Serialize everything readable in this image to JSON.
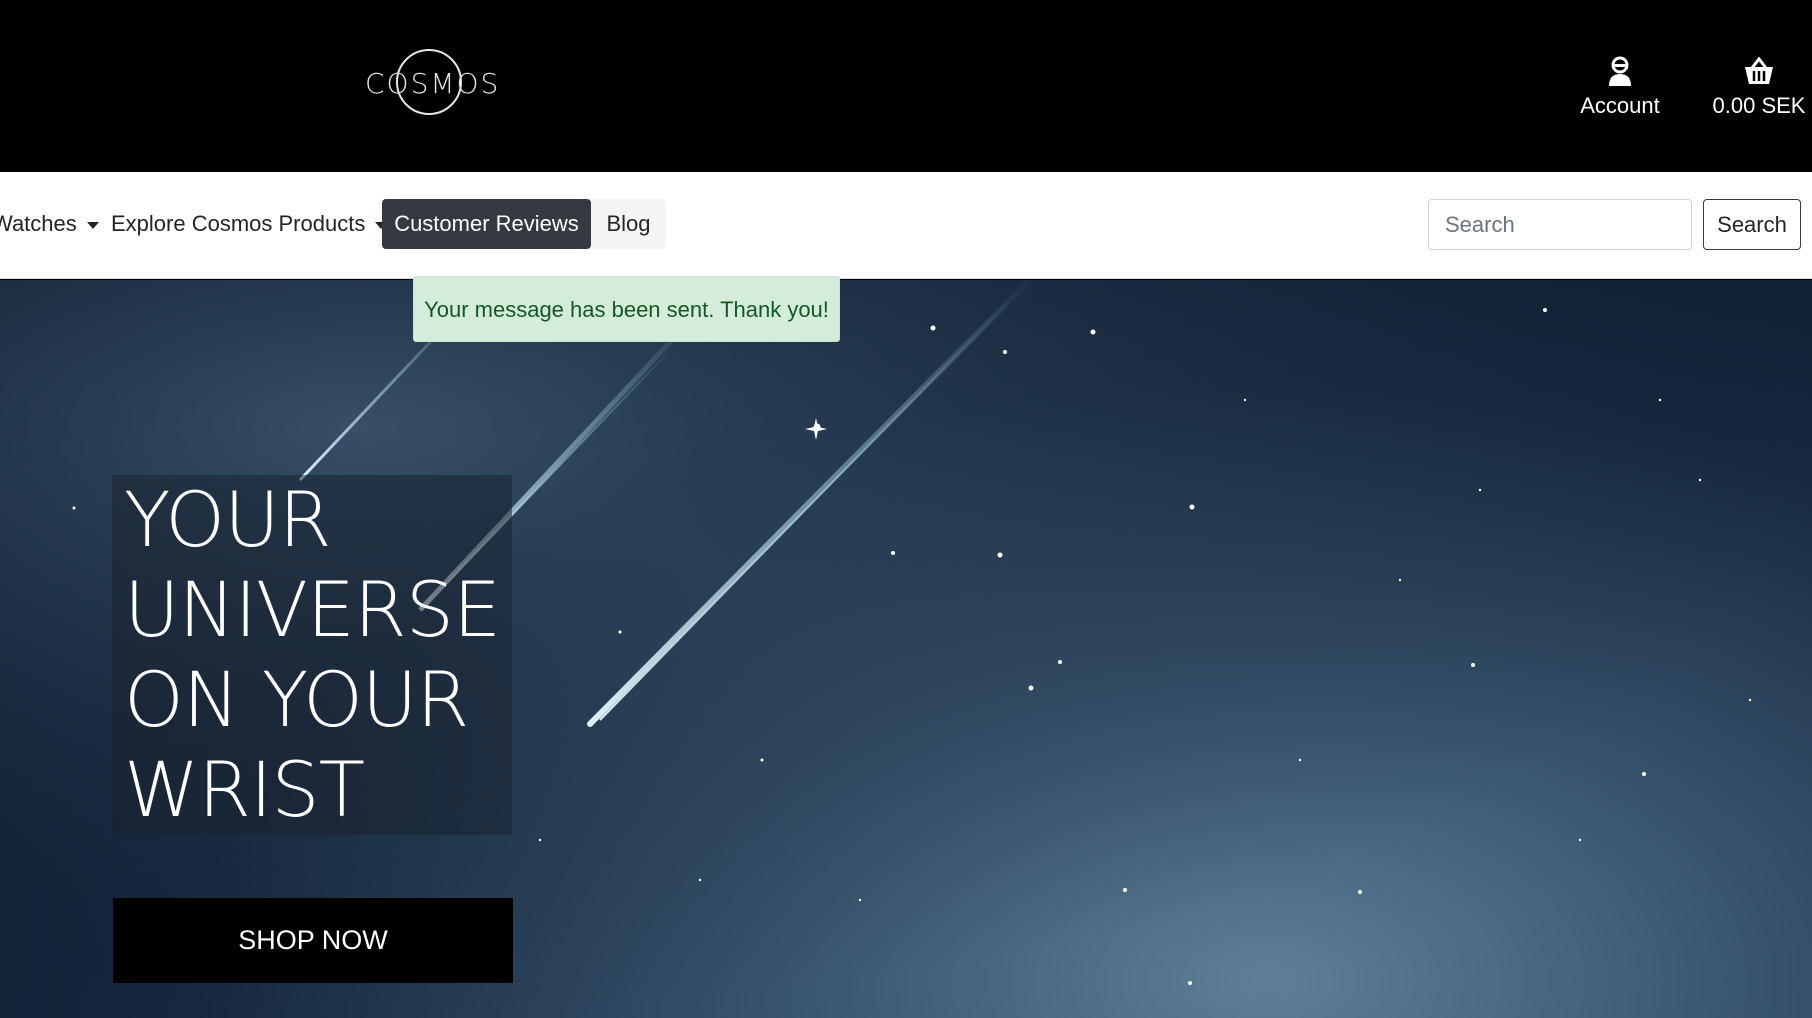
{
  "header": {
    "logo_text": "COSMOS",
    "account_label": "Account",
    "account_icon": "user-icon",
    "cart_total": "0.00 SEK",
    "cart_icon": "basket-icon"
  },
  "nav": {
    "items": [
      {
        "label": "Watches",
        "dropdown": true
      },
      {
        "label": "Explore Cosmos Products",
        "dropdown": true
      },
      {
        "label": "Customer Reviews",
        "active": true
      },
      {
        "label": "Blog"
      }
    ],
    "search_placeholder": "Search",
    "search_button": "Search"
  },
  "alert": {
    "message": "Your message has been sent. Thank you!",
    "color": "#d4edda"
  },
  "hero": {
    "headline_lines": [
      "YOUR",
      "UNIVERSE",
      "ON YOUR",
      "WRIST"
    ],
    "cta_label": "SHOP NOW"
  }
}
